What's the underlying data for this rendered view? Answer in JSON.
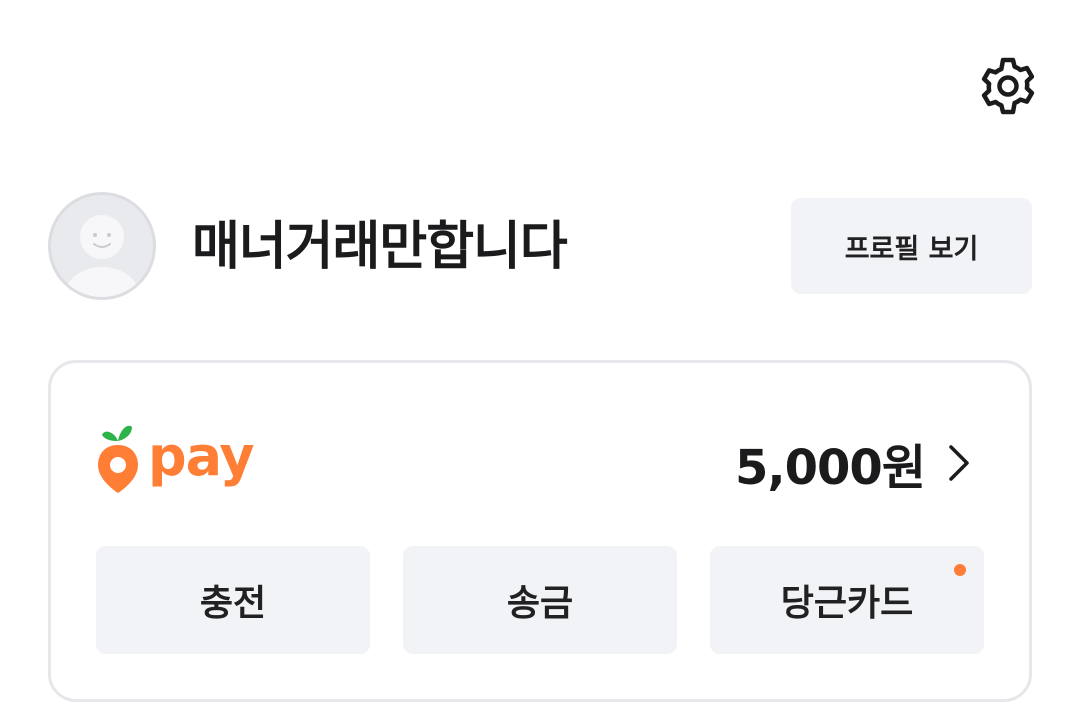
{
  "profile": {
    "nickname": "매너거래만합니다",
    "view_profile_label": "프로필 보기"
  },
  "settings_icon": "gear-icon",
  "pay": {
    "logo_text": "pay",
    "balance": "5,000원",
    "actions": [
      {
        "label": "충전"
      },
      {
        "label": "송금"
      },
      {
        "label": "당근카드",
        "has_new_dot": true
      }
    ]
  },
  "colors": {
    "accent": "#ff7e36",
    "leaf_green": "#2eb24a",
    "button_bg": "#f2f3f6",
    "card_border": "#e6e7ea"
  }
}
